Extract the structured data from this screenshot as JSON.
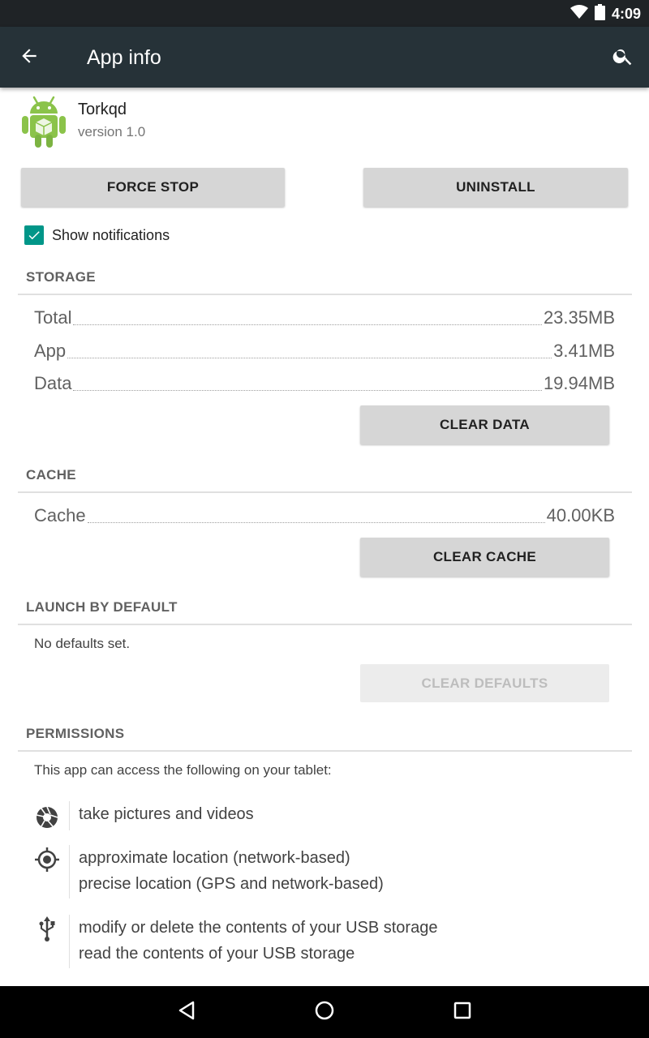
{
  "status_bar": {
    "time": "4:09",
    "icons": [
      "wifi-icon",
      "battery-icon"
    ]
  },
  "app_bar": {
    "title": "App info",
    "back_icon": "arrow-back-icon",
    "search_icon": "search-icon"
  },
  "app": {
    "name": "Torkqd",
    "version": "version 1.0",
    "icon": "android-package-icon"
  },
  "actions": {
    "force_stop": "FORCE STOP",
    "uninstall": "UNINSTALL"
  },
  "notifications": {
    "label": "Show notifications",
    "checked": true
  },
  "storage": {
    "header": "STORAGE",
    "rows": [
      {
        "label": "Total",
        "value": "23.35MB"
      },
      {
        "label": "App",
        "value": "3.41MB"
      },
      {
        "label": "Data",
        "value": "19.94MB"
      }
    ],
    "clear_data": "CLEAR DATA"
  },
  "cache": {
    "header": "CACHE",
    "rows": [
      {
        "label": "Cache",
        "value": "40.00KB"
      }
    ],
    "clear_cache": "CLEAR CACHE"
  },
  "launch_default": {
    "header": "LAUNCH BY DEFAULT",
    "text": "No defaults set.",
    "clear_defaults": "CLEAR DEFAULTS"
  },
  "permissions": {
    "header": "PERMISSIONS",
    "intro": "This app can access the following on your tablet:",
    "groups": [
      {
        "icon": "camera-icon",
        "lines": [
          "take pictures and videos"
        ]
      },
      {
        "icon": "location-icon",
        "lines": [
          "approximate location (network-based)",
          "precise location (GPS and network-based)"
        ]
      },
      {
        "icon": "usb-icon",
        "lines": [
          "modify or delete the contents of your USB storage",
          "read the contents of your USB storage"
        ]
      }
    ]
  },
  "nav_bar": {
    "icons": [
      "back-triangle-icon",
      "home-circle-icon",
      "recents-square-icon"
    ]
  },
  "colors": {
    "app_bar": "#263238",
    "status_bar": "#1f2326",
    "accent": "#009688",
    "button": "#d6d6d6"
  }
}
